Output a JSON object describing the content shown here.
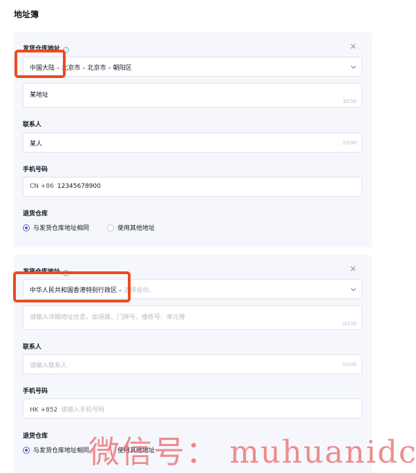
{
  "page": {
    "title": "地址簿"
  },
  "addresses": [
    {
      "warehouse_label": "发货仓库地址",
      "info_icon": "i",
      "close_icon": "×",
      "region": "中国大陆 – 北京市 – 北京市 – 朝阳区",
      "region_placeholder": "",
      "detail_value": "某地址",
      "detail_placeholder": "",
      "detail_count": "3/150",
      "contact_label": "联系人",
      "contact_value": "某人",
      "contact_placeholder": "",
      "contact_count": "2/100",
      "phone_label": "手机号码",
      "phone_prefix": "CN +86",
      "phone_value": "12345678900",
      "phone_placeholder": "",
      "return_label": "退货仓库",
      "return_options": [
        "与发货仓库地址相同",
        "使用其他地址"
      ],
      "return_selected": 0
    },
    {
      "warehouse_label": "发货仓库地址",
      "info_icon": "i",
      "close_icon": "×",
      "region": "中华人民共和国香港特别行政区 –",
      "region_placeholder": "选择省份。",
      "detail_value": "",
      "detail_placeholder": "请输入详细地址信息，如道路、门牌号、楼栋号、单元等",
      "detail_count": "0/150",
      "contact_label": "联系人",
      "contact_value": "",
      "contact_placeholder": "请输入联系人",
      "contact_count": "0/100",
      "phone_label": "手机号码",
      "phone_prefix": "HK +852",
      "phone_value": "",
      "phone_placeholder": "请输入手机号码",
      "return_label": "退货仓库",
      "return_options": [
        "与发货仓库地址相同",
        "使用其他地址"
      ],
      "return_selected": 0
    }
  ],
  "watermark": "微信号： muhuanidc",
  "colors": {
    "highlight": "#ea4b20",
    "radio_active": "#4b57c9",
    "card_bg": "#f5f7fc",
    "watermark": "#e86e6e"
  }
}
